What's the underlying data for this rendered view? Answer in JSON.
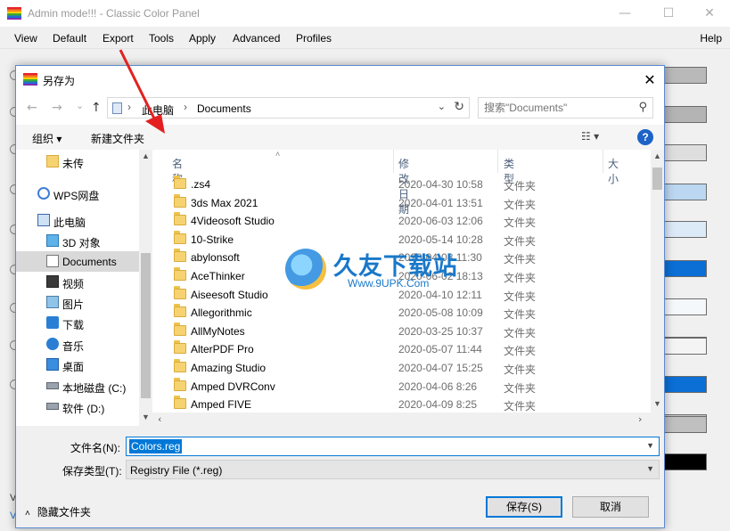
{
  "main_window": {
    "title": "Admin mode!!! - Classic Color Panel",
    "controls": {
      "minimize": "—",
      "maximize": "☐",
      "close": "✕"
    },
    "menu": [
      "View",
      "Default",
      "Export",
      "Tools",
      "Apply",
      "Advanced",
      "Profiles"
    ],
    "help": "Help",
    "left_glyph": "C",
    "bottom_texts": [
      "V",
      "V"
    ],
    "swatch_colors": [
      "#b9b9b9",
      "#b4b4b4",
      "#dedede",
      "#bcd7f1",
      "#dce9f6",
      "#0b6fd6",
      "#f5f8fb",
      "#f0f0f0",
      "#f4f4f4",
      "#0b6fd6",
      "#c8c8c8",
      "#c0c0c0",
      "#000000"
    ]
  },
  "dialog": {
    "title": "另存为",
    "close": "✕",
    "nav": {
      "back": "←",
      "forward": "→",
      "recent": "⌄",
      "up": "↑"
    },
    "breadcrumb": [
      "此电脑",
      "Documents"
    ],
    "search_placeholder": "搜索\"Documents\"",
    "toolbar": {
      "organize": "组织 ▾",
      "new_folder": "新建文件夹",
      "views": "☷ ▾",
      "help": "?"
    },
    "nav_pane": [
      {
        "label": "未传",
        "icon": "folder-icon"
      },
      {
        "label": "WPS网盘",
        "icon": "cloud-icon"
      },
      {
        "label": "此电脑",
        "icon": "computer-icon"
      },
      {
        "label": "3D 对象",
        "icon": "cube-icon"
      },
      {
        "label": "Documents",
        "icon": "document-icon",
        "selected": true
      },
      {
        "label": "视频",
        "icon": "video-icon"
      },
      {
        "label": "图片",
        "icon": "picture-icon"
      },
      {
        "label": "下载",
        "icon": "download-icon"
      },
      {
        "label": "音乐",
        "icon": "music-icon"
      },
      {
        "label": "桌面",
        "icon": "desktop-icon"
      },
      {
        "label": "本地磁盘 (C:)",
        "icon": "drive-icon"
      },
      {
        "label": "软件 (D:)",
        "icon": "drive-icon"
      }
    ],
    "columns": [
      "名称",
      "修改日期",
      "类型",
      "大小"
    ],
    "files": [
      {
        "name": ".zs4",
        "date": "2020-04-30 10:58",
        "type": "文件夹"
      },
      {
        "name": "3ds Max 2021",
        "date": "2020-04-01 13:51",
        "type": "文件夹"
      },
      {
        "name": "4Videosoft Studio",
        "date": "2020-06-03 12:06",
        "type": "文件夹"
      },
      {
        "name": "10-Strike",
        "date": "2020-05-14 10:28",
        "type": "文件夹"
      },
      {
        "name": "abylonsoft",
        "date": "2020-04-08 11:30",
        "type": "文件夹"
      },
      {
        "name": "AceThinker",
        "date": "2020-06-02 18:13",
        "type": "文件夹"
      },
      {
        "name": "Aiseesoft Studio",
        "date": "2020-04-10 12:11",
        "type": "文件夹"
      },
      {
        "name": "Allegorithmic",
        "date": "2020-05-08 10:09",
        "type": "文件夹"
      },
      {
        "name": "AllMyNotes",
        "date": "2020-03-25 10:37",
        "type": "文件夹"
      },
      {
        "name": "AlterPDF Pro",
        "date": "2020-05-07 11:44",
        "type": "文件夹"
      },
      {
        "name": "Amazing Studio",
        "date": "2020-04-07 15:25",
        "type": "文件夹"
      },
      {
        "name": "Amped DVRConv",
        "date": "2020-04-06 8:26",
        "type": "文件夹"
      },
      {
        "name": "Amped FIVE",
        "date": "2020-04-09 8:25",
        "type": "文件夹"
      }
    ],
    "filename_label": "文件名(N):",
    "filename_value": "Colors.reg",
    "filetype_label": "保存类型(T):",
    "filetype_value": "Registry File (*.reg)",
    "hide_folders": "隐藏文件夹",
    "save": "保存(S)",
    "cancel": "取消"
  },
  "watermark": {
    "brand": "久友下载站",
    "url": "Www.9UPK.Com"
  }
}
